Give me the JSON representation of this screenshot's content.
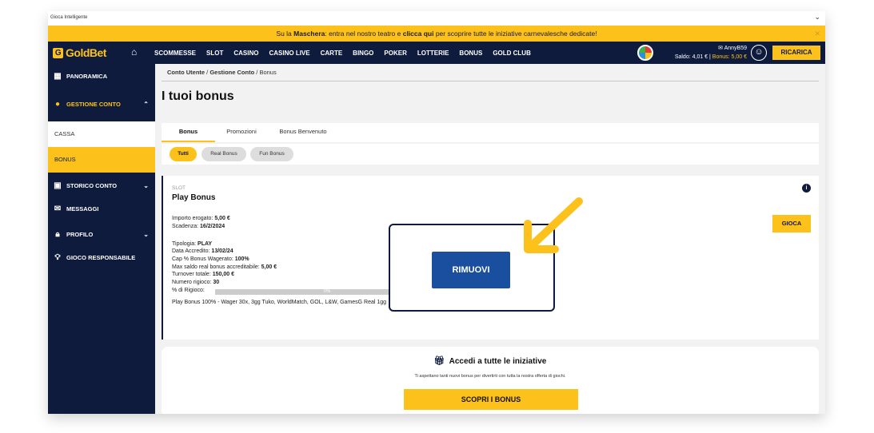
{
  "window": {
    "title": "Gioca Intelligente"
  },
  "promo_banner": {
    "pre": "Su la ",
    "bold1": "Maschera",
    "mid": ": entra nel nostro teatro e ",
    "bold2": "clicca qui",
    "post": " per scoprire tutte le iniziative carnevalesche dedicate!"
  },
  "header": {
    "logo": "GoldBet",
    "logo_mark": "G",
    "nav": [
      "SCOMMESSE",
      "SLOT",
      "CASINO",
      "CASINO LIVE",
      "CARTE",
      "BINGO",
      "POKER",
      "LOTTERIE",
      "BONUS",
      "GOLD CLUB"
    ],
    "username": "AnnyB59",
    "saldo": "Saldo: 4,01 €",
    "bonus": "Bonus: 5,00 €",
    "ricarica": "RICARICA"
  },
  "sidebar": {
    "panoramica": "PANORAMICA",
    "gestione_conto": "GESTIONE CONTO",
    "cassa": "CASSA",
    "bonus": "BONUS",
    "storico_conto": "STORICO CONTO",
    "messaggi": "MESSAGGI",
    "profilo": "PROFILO",
    "gioco_responsabile": "GIOCO RESPONSABILE"
  },
  "breadcrumb": {
    "part1": "Conto Utente",
    "part2": "Gestione Conto",
    "part3": "Bonus",
    "sep": " / "
  },
  "page_title": "I tuoi bonus",
  "tabs": [
    "Bonus",
    "Promozioni",
    "Bonus Benvenuto"
  ],
  "filters": [
    "Tutti",
    "Real Bonus",
    "Fun Bonus"
  ],
  "bonus_card": {
    "category": "SLOT",
    "name": "Play Bonus",
    "importo_label": "Importo erogato: ",
    "importo": "5,00 €",
    "scadenza_label": "Scadenza: ",
    "scadenza": "16/2/2024",
    "tipologia_label": "Tipologia: ",
    "tipologia": "PLAY",
    "data_label": "Data Accredito: ",
    "data": "13/02/24",
    "cap_label": "Cap % Bonus Wagerato: ",
    "cap": "100%",
    "max_label": "Max saldo real bonus accreditabile: ",
    "max": "5,00 €",
    "turnover_label": "Turnover totale: ",
    "turnover": "150,00 €",
    "numero_label": "Numero rigioco: ",
    "numero": "30",
    "rigioco_label": "% di Rigioco:",
    "rigioco_pct_text": "0%",
    "rigioco_progress": 0,
    "description": "Play Bonus 100% - Wager 30x, 3gg Tuko, WorldMatch, GOL, L&W, GamesG Real 1gg",
    "gioca": "GIOCA",
    "rimuovi": "RIMUOVI"
  },
  "cta": {
    "title": "Accedi a tutte le iniziative",
    "subtitle": "Ti aspettano tanti nuovi bonus per divertirti con tutta la nostra offerta di giochi.",
    "button": "SCOPRI I BONUS"
  },
  "colors": {
    "brand_yellow": "#fcc21b",
    "navy": "#0f1b3d",
    "remove_blue": "#1a4fa0"
  }
}
